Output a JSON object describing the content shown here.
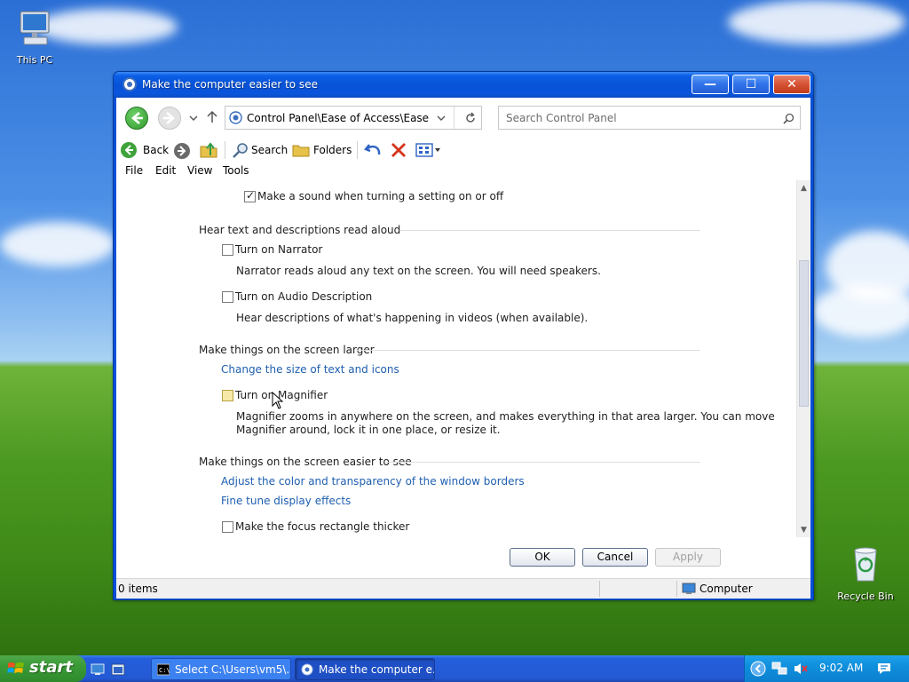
{
  "desktop": {
    "icons": [
      {
        "label": "This PC"
      },
      {
        "label": "Recycle Bin"
      }
    ]
  },
  "window": {
    "title": "Make the computer easier to see",
    "controls": {
      "minimize": "—",
      "maximize": "☐",
      "close": "✕"
    },
    "address": "Control Panel\\Ease of Access\\Ease of A",
    "search_placeholder": "Search Control Panel",
    "toolbar": {
      "back": "Back",
      "search": "Search",
      "folders": "Folders"
    },
    "menu": [
      "File",
      "Edit",
      "View",
      "Tools"
    ],
    "content": {
      "sound_option": {
        "label": "Make a sound when turning a setting on or off",
        "checked": true
      },
      "sections": [
        {
          "heading": "Hear text and descriptions read aloud",
          "options": [
            {
              "label": "Turn on Narrator",
              "checked": false,
              "description": "Narrator reads aloud any text on the screen. You will need speakers."
            },
            {
              "label": "Turn on Audio Description",
              "checked": false,
              "description": "Hear descriptions of what's happening in videos (when available)."
            }
          ]
        },
        {
          "heading": "Make things on the screen larger",
          "links": [
            "Change the size of text and icons"
          ],
          "options": [
            {
              "label": "Turn on Magnifier",
              "checked": false,
              "description_line1": "Magnifier zooms in anywhere on the screen, and makes everything in that area larger. You can move",
              "description_line2": "Magnifier around, lock it in one place, or resize it."
            }
          ]
        },
        {
          "heading": "Make things on the screen easier to see",
          "links": [
            "Adjust the color and transparency of the window borders",
            "Fine tune display effects"
          ],
          "options": [
            {
              "label": "Make the focus rectangle thicker",
              "checked": false
            }
          ]
        }
      ]
    },
    "buttons": {
      "ok": "OK",
      "cancel": "Cancel",
      "apply": "Apply"
    },
    "status": {
      "items": "0 items",
      "location": "Computer"
    }
  },
  "taskbar": {
    "start": "start",
    "tasks": [
      {
        "label": "Select C:\\Users\\vm5\\..."
      },
      {
        "label": "Make the computer e..."
      }
    ],
    "clock": "9:02 AM"
  },
  "colors": {
    "titlebar": "#0852d6",
    "link": "#1f5fb0",
    "taskbar": "#245edb",
    "start_button": "#3b9a36",
    "tray": "#0f8fdc"
  }
}
